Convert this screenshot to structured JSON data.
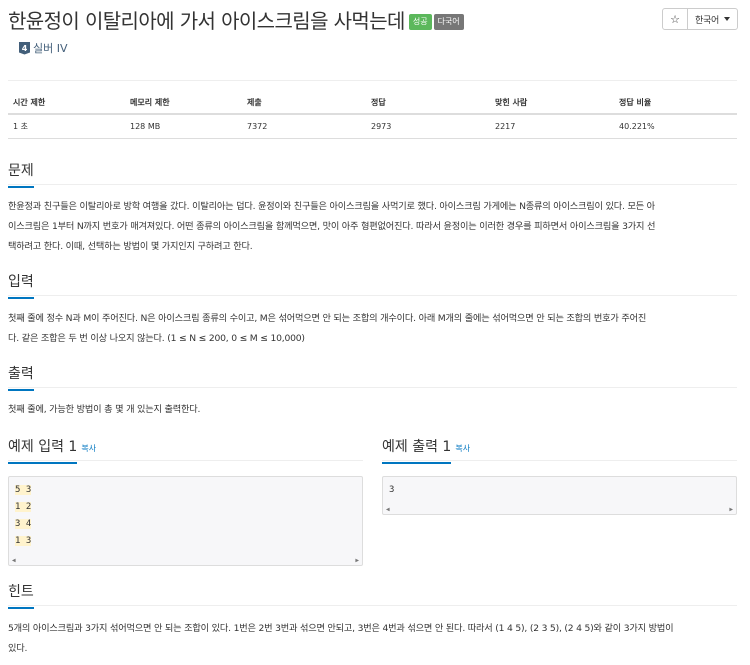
{
  "header": {
    "title": "한윤정이 이탈리아에 가서 아이스크림을 사먹는데",
    "badges": [
      {
        "label": "성공",
        "color": "#5cb85c"
      },
      {
        "label": "다국어",
        "color": "#777777"
      }
    ],
    "star_icon": "star-icon",
    "language": "한국어"
  },
  "tier": {
    "icon": "4",
    "label": "실버 IV",
    "color": "#435f7a"
  },
  "info_table": {
    "headers": [
      "시간 제한",
      "메모리 제한",
      "제출",
      "정답",
      "맞힌 사람",
      "정답 비율"
    ],
    "values": [
      "1 초",
      "128 MB",
      "7372",
      "2973",
      "2217",
      "40.221%"
    ]
  },
  "sections": {
    "problem": {
      "title": "문제",
      "lines": [
        "한윤정과 친구들은 이탈리아로 방학 여행을 갔다. 이탈리아는 덥다. 윤정이와 친구들은 아이스크림을 사먹기로 했다. 아이스크림 가게에는 N종류의 아이스크림이 있다. 모든 아",
        "이스크림은 1부터 N까지 번호가 매겨져있다. 어떤 종류의 아이스크림을 함께먹으면, 맛이 아주 형편없어진다. 따라서 윤정이는 이러한 경우를 피하면서 아이스크림을 3가지 선",
        "택하려고 한다. 이때, 선택하는 방법이 몇 가지인지 구하려고 한다."
      ]
    },
    "input": {
      "title": "입력",
      "lines": [
        "첫째 줄에 정수 N과 M이 주어진다. N은 아이스크림 종류의 수이고, M은 섞어먹으면 안 되는 조합의 개수이다. 아래 M개의 줄에는 섞어먹으면 안 되는 조합의 번호가 주어진",
        "다. 같은 조합은 두 번 이상 나오지 않는다. (1 ≤ N ≤ 200, 0 ≤ M ≤ 10,000)"
      ]
    },
    "output": {
      "title": "출력",
      "lines": [
        "첫째 줄에, 가능한 방법이 총 몇 개 있는지 출력한다."
      ]
    },
    "hint": {
      "title": "힌트",
      "lines": [
        "5개의 아이스크림과 3가지 섞어먹으면 안 되는 조합이 있다. 1번은 2번 3번과 섞으면 안되고, 3번은 4번과 섞으면 안 된다. 따라서 (1 4 5), (2 3 5), (2 4 5)와 같이 3가지 방법이",
        "있다."
      ]
    }
  },
  "examples": {
    "copy_label": "복사",
    "input": {
      "title": "예제 입력 1",
      "lines": [
        "5 3",
        "1 2",
        "3 4",
        "1 3"
      ]
    },
    "output": {
      "title": "예제 출력 1",
      "lines": [
        "3"
      ]
    }
  },
  "scrollbar": {
    "left_arrow": "◀",
    "right_arrow": "▶"
  }
}
